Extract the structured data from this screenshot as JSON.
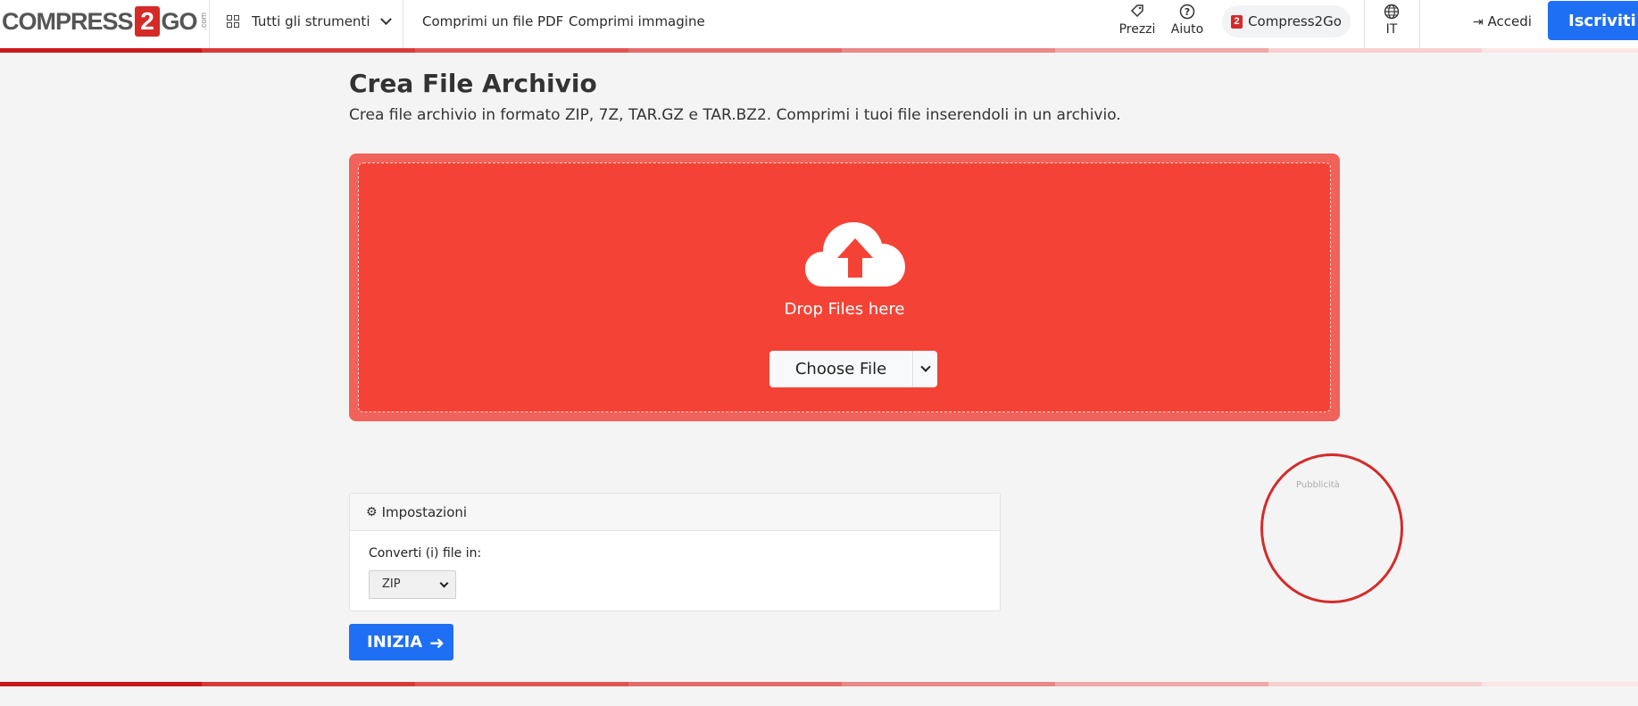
{
  "header": {
    "logo": {
      "left": "COMPRESS",
      "mid": "2",
      "right": "GO",
      "suffix": ".com"
    },
    "tools_label": "Tutti gli strumenti",
    "nav": [
      "Comprimi un file PDF",
      "Comprimi immagine"
    ],
    "prices_label": "Prezzi",
    "help_label": "Aiuto",
    "brand_pill": "Compress2Go",
    "language": "IT",
    "login_label": "Accedi",
    "signup_label": "Iscriviti"
  },
  "main": {
    "title": "Crea File Archivio",
    "subtitle": "Crea file archivio in formato ZIP, 7Z, TAR.GZ e TAR.BZ2. Comprimi i tuoi file inserendoli in un archivio.",
    "dropzone": {
      "drop_text": "Drop Files here",
      "choose_label": "Choose File"
    },
    "settings": {
      "heading": "Impostazioni",
      "convert_label": "Converti (i) file in:",
      "format_value": "ZIP"
    },
    "start_label": "INIZIA"
  },
  "ad": {
    "label": "Pubblicità"
  },
  "colors": {
    "brand_red": "#d52a28",
    "dropzone": "#f44336",
    "primary_blue": "#1f6ff4",
    "annotation_circle": "#d42b2b"
  },
  "stripe_colors": [
    "#c9171b",
    "#d93a39",
    "#e05453",
    "#e46b6a",
    "#ea8888",
    "#f0a8a8",
    "#f7d0d0",
    "#fbe6e6"
  ]
}
